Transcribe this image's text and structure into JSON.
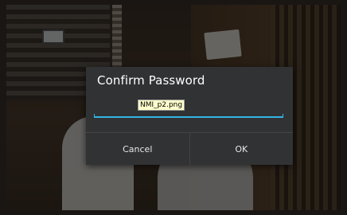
{
  "dialog": {
    "title": "Confirm Password",
    "password_field": {
      "value": "NMI_p2.png"
    },
    "buttons": {
      "cancel_label": "Cancel",
      "ok_label": "OK"
    }
  },
  "colors": {
    "dialog_background": "#313233",
    "accent": "#33b5e5",
    "title_text": "#ffffff",
    "button_text": "#e8e8e8"
  }
}
